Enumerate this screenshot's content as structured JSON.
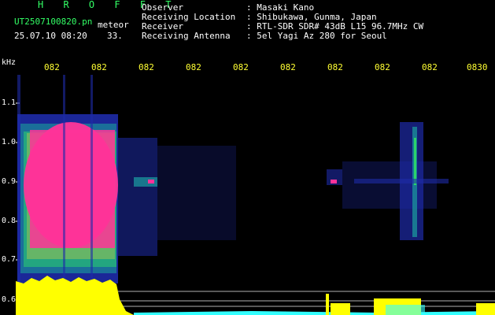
{
  "header": {
    "app_name": "H R O F F T",
    "file_name": "UT2507100820.pn",
    "tag": "meteor",
    "timestamp": "25.07.10 08:20",
    "aux": "33."
  },
  "info": [
    {
      "label": "Observer",
      "value": ": Masaki Kano"
    },
    {
      "label": "Receiving Location",
      "value": ": Shibukawa, Gunma, Japan"
    },
    {
      "label": "Receiver",
      "value": ": RTL-SDR SDR# 43dB L15 96.7MHz CW"
    },
    {
      "label": "Receiving Antenna",
      "value": ": 5el Yagi Az 280 for Seoul"
    }
  ],
  "axis": {
    "y_unit": "kHz",
    "y_ticks": [
      "1.1",
      "1.0",
      "0.9",
      "0.8",
      "0.7",
      "0.6"
    ],
    "x_ticks": [
      "082",
      "082",
      "082",
      "082",
      "082",
      "082",
      "082",
      "082",
      "082",
      "0830"
    ]
  },
  "colors": {
    "text_white": "#ffffff",
    "title_green": "#33ff66",
    "tick_yellow": "#ffff33",
    "signal_magenta": "#ff3399",
    "noise_blue": "#1e2ba8",
    "amplitude_yellow": "#ffff00",
    "amplitude_cyan": "#33ffff"
  }
}
